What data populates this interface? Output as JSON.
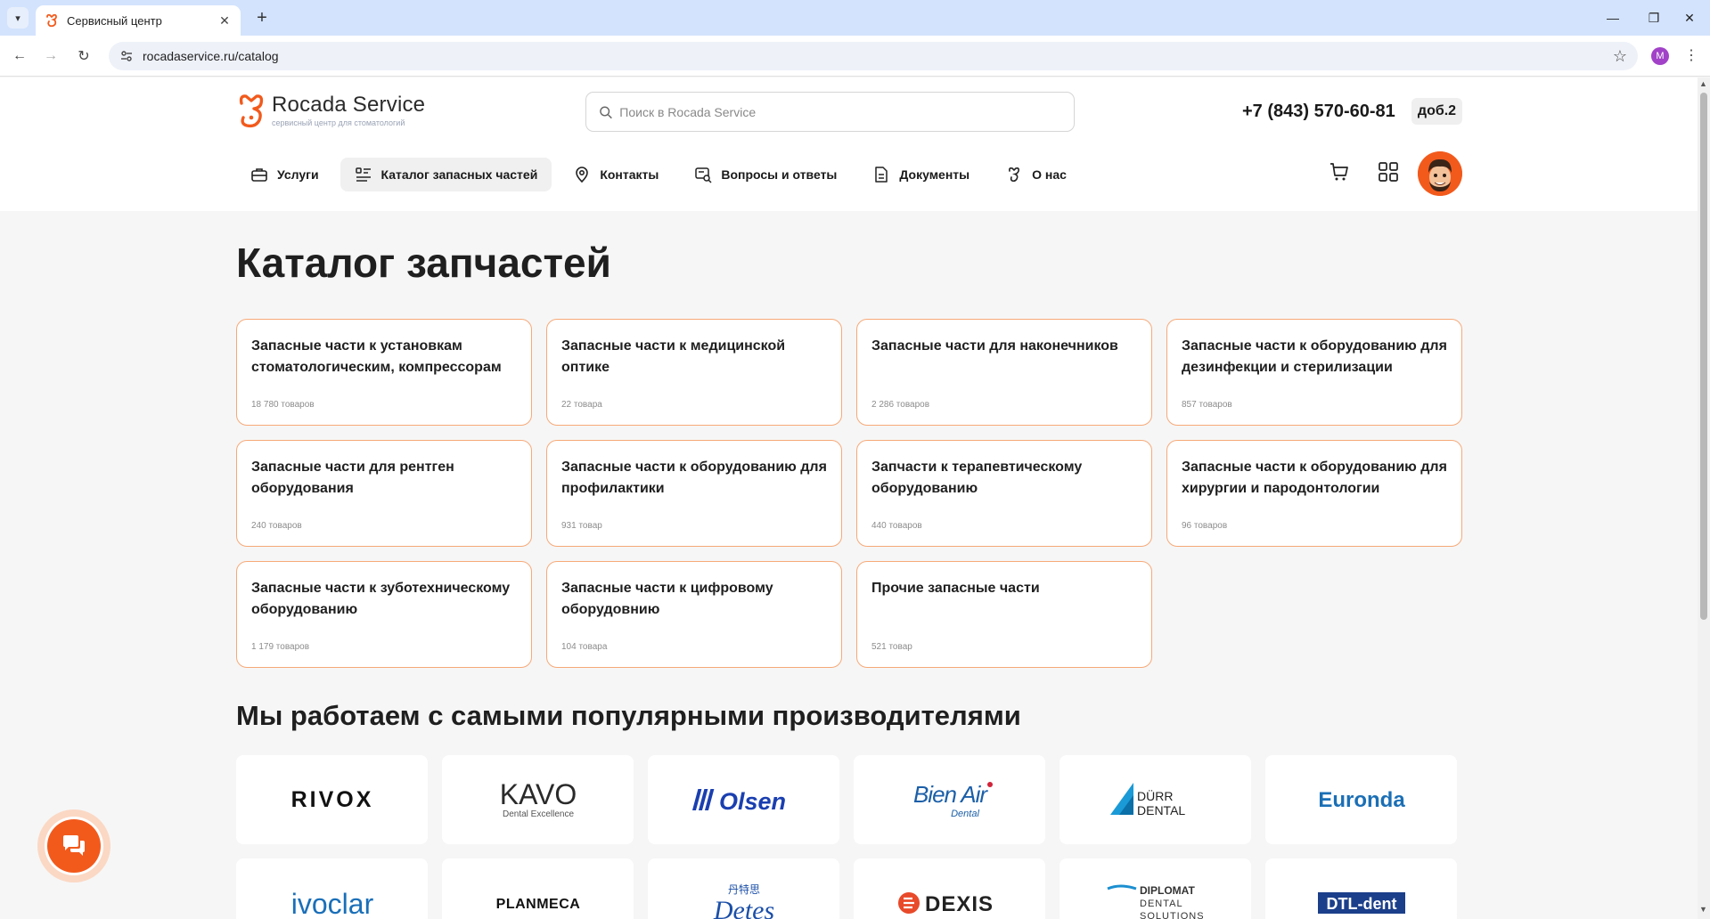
{
  "browser": {
    "tab_title": "Сервисный центр",
    "url": "rocadaservice.ru/catalog",
    "profile_initial": "M"
  },
  "header": {
    "brand_name": "Rocada Service",
    "brand_sub": "сервисный центр для стоматологий",
    "search_placeholder": "Поиск в Rocada Service",
    "phone": "+7 (843) 570-60-81",
    "ext": "доб.2",
    "accent_color": "#f25a1c"
  },
  "menu": [
    {
      "label": "Услуги",
      "icon": "briefcase-icon"
    },
    {
      "label": "Каталог запасных частей",
      "icon": "list-icon"
    },
    {
      "label": "Контакты",
      "icon": "location-pin-icon"
    },
    {
      "label": "Вопросы и ответы",
      "icon": "search-doc-icon"
    },
    {
      "label": "Документы",
      "icon": "document-icon"
    },
    {
      "label": "О нас",
      "icon": "tooth-icon"
    }
  ],
  "page": {
    "title": "Каталог запчастей",
    "makers_title": "Мы работаем с самыми популярными производителями"
  },
  "categories": [
    {
      "title": "Запасные части к установкам стоматологическим, компрессорам",
      "count": "18 780 товаров"
    },
    {
      "title": "Запасные части к медицинской оптике",
      "count": "22 товара"
    },
    {
      "title": "Запасные части для наконечников",
      "count": "2 286 товаров"
    },
    {
      "title": "Запасные части к оборудованию для дезинфекции и стерилизации",
      "count": "857 товаров"
    },
    {
      "title": "Запасные части для рентген оборудования",
      "count": "240 товаров"
    },
    {
      "title": "Запасные части к оборудованию для профилактики",
      "count": "931 товар"
    },
    {
      "title": "Запчасти к терапевтическому оборудованию",
      "count": "440 товаров"
    },
    {
      "title": "Запасные части к оборудованию для хирургии и пародонтологии",
      "count": "96 товаров"
    },
    {
      "title": "Запасные части к зуботехническому оборудованию",
      "count": "1 179 товаров"
    },
    {
      "title": "Запасные части к цифровому оборудовнию",
      "count": "104 товара"
    },
    {
      "title": "Прочие запасные части",
      "count": "521 товар"
    }
  ],
  "makers": {
    "rivox": "RIVOX",
    "kavo": "KAVO",
    "kavo_sub": "Dental Excellence",
    "olsen": "Olsen",
    "bienair": "Bien Air",
    "bienair_sub": "Dental",
    "durr1": "DÜRR",
    "durr2": "DENTAL",
    "euronda": "Euronda",
    "ivoclar": "ivoclar",
    "planmeca": "PLANMECA",
    "detes": "Detes",
    "detes_cn": "丹特思",
    "dexis": "DEXIS",
    "diplomat1": "DIPLOMAT",
    "diplomat2": "DENTAL",
    "diplomat3": "SOLUTIONS",
    "dtl": "DTL-dent"
  }
}
